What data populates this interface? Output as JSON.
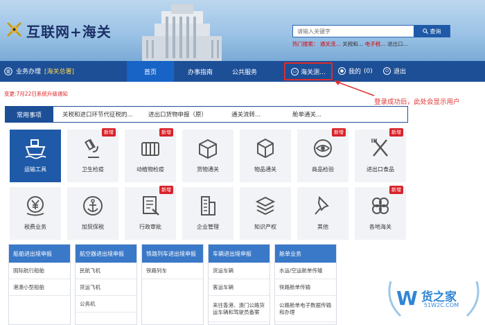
{
  "header": {
    "logo_title": "互联网+海关",
    "search_placeholder": "请输入关键字",
    "search_button": "查询",
    "hot_label": "热门搜索：",
    "hot_1": "通关流…",
    "hot_2": "关税和…",
    "hot_3": "电子税…",
    "hot_4": "进出口…"
  },
  "nav": {
    "business": "业务办理",
    "org": "[海关总署]",
    "home": "首页",
    "guide": "办事指南",
    "public": "公共服务",
    "user": "海关测…",
    "mine": "我的",
    "mine_count": "(0)",
    "exit": "退出"
  },
  "notice": "变更:7月22日系统升级通知",
  "annotation": "登录成功后，此处会显示用户",
  "tabs": {
    "active": "常用事项",
    "links": [
      "关税和进口环节代征税的...",
      "进出口货物申报（原）",
      "通关流转...",
      "舱单通关..."
    ]
  },
  "tiles_row1": [
    {
      "label": "运输工具",
      "badge": ""
    },
    {
      "label": "卫生检疫",
      "badge": "新增"
    },
    {
      "label": "动植物检疫",
      "badge": "新增"
    },
    {
      "label": "货物通关",
      "badge": ""
    },
    {
      "label": "物品通关",
      "badge": ""
    },
    {
      "label": "商品检验",
      "badge": "新增"
    },
    {
      "label": "进出口食品",
      "badge": "新增"
    }
  ],
  "tiles_row2": [
    {
      "label": "税费业务",
      "badge": ""
    },
    {
      "label": "加贸保税",
      "badge": ""
    },
    {
      "label": "行政审批",
      "badge": "新增"
    },
    {
      "label": "企业管理",
      "badge": ""
    },
    {
      "label": "知识产权",
      "badge": ""
    },
    {
      "label": "其他",
      "badge": ""
    },
    {
      "label": "各地海关",
      "badge": "新增"
    }
  ],
  "columns": [
    {
      "title": "船舶进出境申报",
      "items": [
        "国际航行船舶",
        "港澳小型船舶"
      ]
    },
    {
      "title": "航空器进出境申报",
      "items": [
        "民航飞机",
        "货运飞机",
        "公务机"
      ]
    },
    {
      "title": "铁路列车进出境申报",
      "items": [
        "铁路列车"
      ]
    },
    {
      "title": "车辆进出境申报",
      "items": [
        "货运车辆",
        "客运车辆",
        "来往香港、澳门公路货运车辆和驾驶员备案"
      ]
    },
    {
      "title": "舱单业务",
      "items": [
        "水运/空运舱单传输",
        "铁路舱单传输",
        "公路舱单电子数据传输和办理"
      ]
    }
  ],
  "watermark": {
    "name": "货之家",
    "domain": "51W2C.COM"
  },
  "colors": {
    "primary": "#1d4f97",
    "accent": "#1764c6",
    "badge": "#d8232a",
    "highlight": "#e02b2b"
  }
}
